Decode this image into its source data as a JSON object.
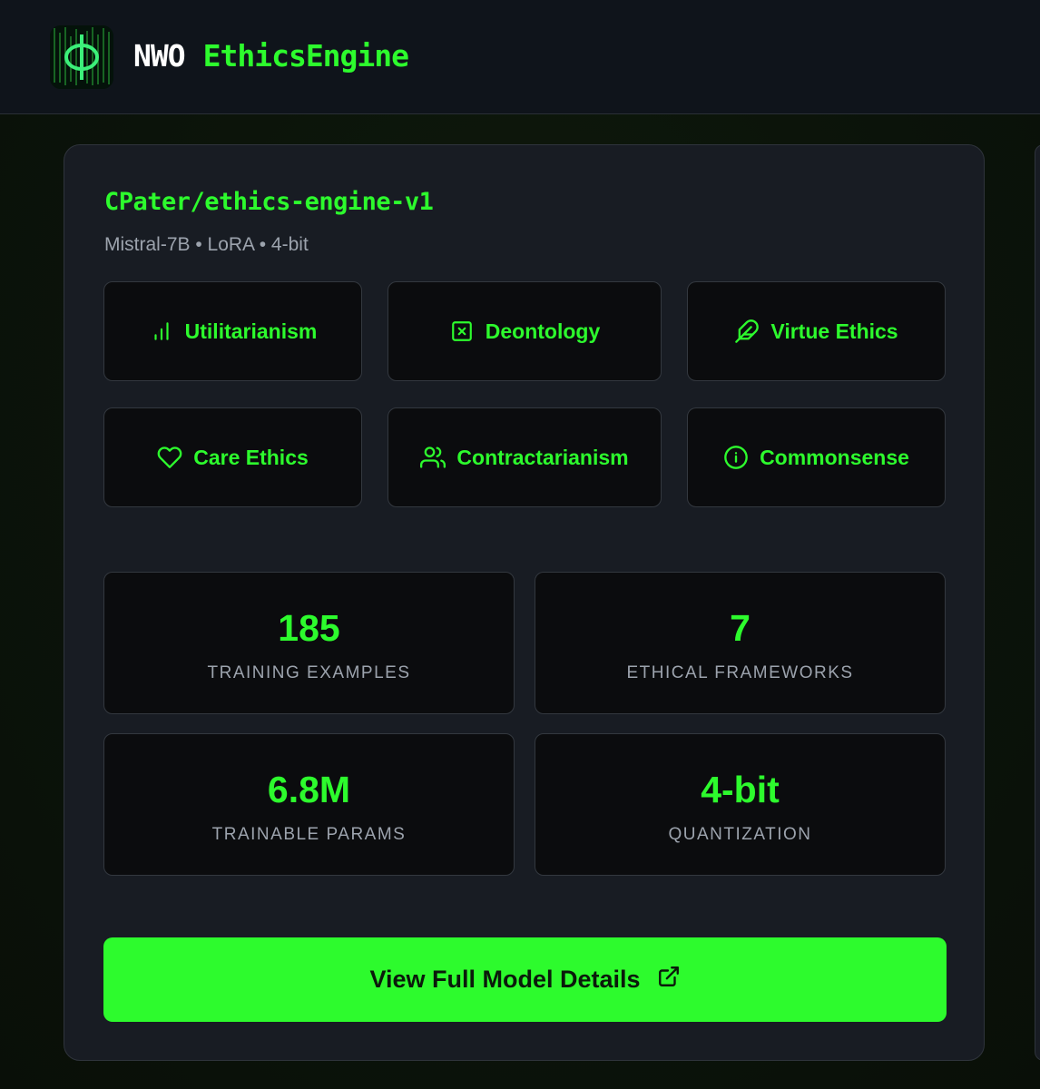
{
  "header": {
    "brand_prefix": "NWO",
    "brand_name": "EthicsEngine",
    "logo_icon": "phi-matrix-logo"
  },
  "model": {
    "name": "CPater/ethics-engine-v1",
    "meta": "Mistral-7B • LoRA • 4-bit"
  },
  "frameworks": [
    {
      "label": "Utilitarianism",
      "icon": "bar-chart-icon"
    },
    {
      "label": "Deontology",
      "icon": "x-square-icon"
    },
    {
      "label": "Virtue Ethics",
      "icon": "feather-icon"
    },
    {
      "label": "Care Ethics",
      "icon": "heart-icon"
    },
    {
      "label": "Contractarianism",
      "icon": "users-icon"
    },
    {
      "label": "Commonsense",
      "icon": "info-icon"
    }
  ],
  "stats": [
    {
      "value": "185",
      "label": "TRAINING EXAMPLES"
    },
    {
      "value": "7",
      "label": "ETHICAL FRAMEWORKS"
    },
    {
      "value": "6.8M",
      "label": "TRAINABLE PARAMS"
    },
    {
      "value": "4-bit",
      "label": "QUANTIZATION"
    }
  ],
  "cta": {
    "label": "View Full Model Details",
    "icon": "external-link-icon"
  },
  "colors": {
    "accent": "#2dfb2d",
    "card": "#181c23",
    "tile": "#0b0c0e",
    "muted": "#9ca3ad"
  }
}
